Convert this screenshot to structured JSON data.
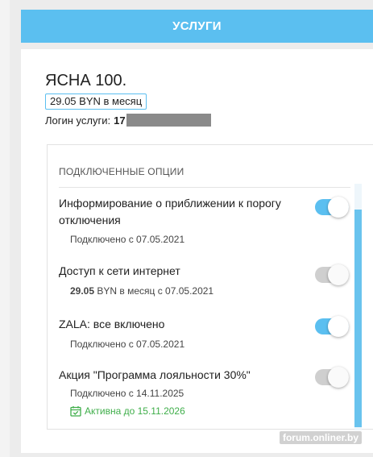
{
  "header": {
    "tab_label": "УСЛУГИ"
  },
  "service": {
    "name": "ЯСНА 100.",
    "price": "29.05 BYN в месяц",
    "login_label": "Логин услуги:",
    "login_value_visible": "17"
  },
  "options": {
    "title": "ПОДКЛЮЧЕННЫЕ ОПЦИИ",
    "items": [
      {
        "title": "Информирование о приближении к порогу отключения",
        "sub": "Подключено с 07.05.2021",
        "enabled": true
      },
      {
        "title": "Доступ к сети интернет",
        "sub_price": "29.05",
        "sub_rest": " BYN в месяц с 07.05.2021",
        "enabled": false
      },
      {
        "title": "ZALA: все включено",
        "sub": "Подключено с 07.05.2021",
        "enabled": true
      },
      {
        "title": "Акция \"Программа лояльности 30%\"",
        "sub": "Подключено с 14.11.2025",
        "active_until": "Активна до 15.11.2026",
        "enabled": false
      }
    ]
  },
  "colors": {
    "accent": "#5bbff0",
    "active_green": "#3fae4a",
    "toggle_off": "#cfcfcf"
  },
  "watermark": "forum.onliner.by"
}
